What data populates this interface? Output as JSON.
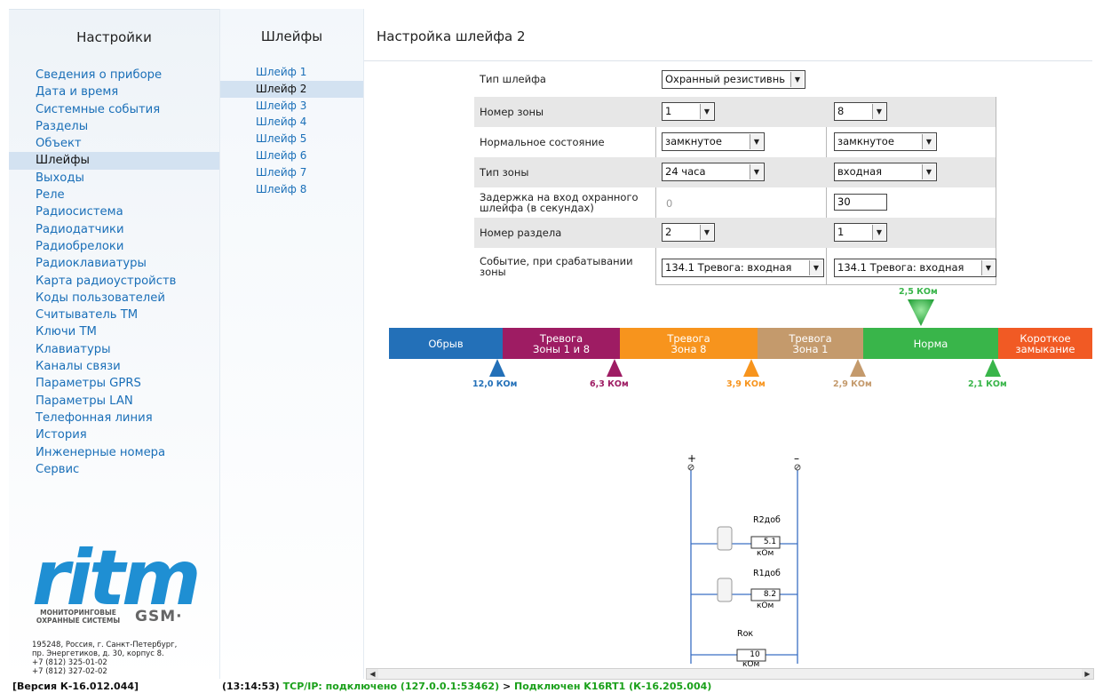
{
  "left": {
    "title": "Настройки",
    "items": [
      "Сведения о приборе",
      "Дата и время",
      "Системные события",
      "Разделы",
      "Объект",
      "Шлейфы",
      "Выходы",
      "Реле",
      "Радиосистема",
      "Радиодатчики",
      "Радиобрелоки",
      "Радиоклавиатуры",
      "Карта радиоустройств",
      "Коды пользователей",
      "Считыватель ТМ",
      "Ключи ТМ",
      "Клавиатуры",
      "Каналы связи",
      "Параметры GPRS",
      "Параметры LAN",
      "Телефонная линия",
      "История",
      "Инженерные номера",
      "Сервис"
    ],
    "active_index": 5
  },
  "logo": {
    "brand": "ritm",
    "tagline": "МОНИТОРИНГОВЫЕ ОХРАННЫЕ СИСТЕМЫ",
    "gsm": "GSM·"
  },
  "address": [
    "195248, Россия, г. Санкт-Петербург,",
    "пр. Энергетиков, д. 30, корпус 8.",
    "+7 (812) 325-01-02",
    "+7 (812) 327-02-02"
  ],
  "mid": {
    "title": "Шлейфы",
    "items": [
      "Шлейф 1",
      "Шлейф 2",
      "Шлейф 3",
      "Шлейф 4",
      "Шлейф 5",
      "Шлейф 6",
      "Шлейф 7",
      "Шлейф 8"
    ],
    "active_index": 1
  },
  "main": {
    "title": "Настройка шлейфа 2"
  },
  "form": {
    "loop_type_label": "Тип шлейфа",
    "loop_type_value": "Охранный резистивнь",
    "rows": [
      {
        "label": "Номер зоны",
        "a": "1",
        "b": "8"
      },
      {
        "label": "Нормальное состояние",
        "a": "замкнутое",
        "b": "замкнутое"
      },
      {
        "label": "Тип зоны",
        "a": "24 часа",
        "b": "входная"
      },
      {
        "label": "Задержка на вход охранного шлейфа (в секундах)",
        "a": "0",
        "b": "30"
      },
      {
        "label": "Номер раздела",
        "a": "2",
        "b": "1"
      },
      {
        "label": "Событие, при срабатывании зоны",
        "a": "134.1 Тревога: входная",
        "b": "134.1 Тревога: входная"
      }
    ]
  },
  "scale": {
    "segments": [
      {
        "label": "Обрыв",
        "color": "#2370b8"
      },
      {
        "label": "Тревога Зоны 1 и 8",
        "color": "#9e1c63"
      },
      {
        "label": "Тревога Зона 8",
        "color": "#f7941d"
      },
      {
        "label": "Тревога Зона 1",
        "color": "#c49a6c"
      },
      {
        "label": "Норма",
        "color": "#39b54a"
      },
      {
        "label": "Короткое замыкание",
        "color": "#f15a24"
      }
    ],
    "top_marker": {
      "label": "2,5 КОм",
      "color": "#39b54a"
    },
    "bottom_markers": [
      {
        "label": "12,0 КОм",
        "color": "#2370b8"
      },
      {
        "label": "6,3 КОм",
        "color": "#9e1c63"
      },
      {
        "label": "3,9 КОм",
        "color": "#f7941d"
      },
      {
        "label": "2,9 КОм",
        "color": "#c49a6c"
      },
      {
        "label": "2,1 КОм",
        "color": "#39b54a"
      }
    ]
  },
  "circuit": {
    "plus": "+",
    "minus": "–",
    "r2_name": "R2доб",
    "r2_value": "5.1",
    "r1_name": "R1доб",
    "r1_value": "8.2",
    "rok_name": "Rок",
    "rok_value": "10",
    "unit": "кОм"
  },
  "status": {
    "version": "[Версия К-16.012.044]",
    "time": "(13:14:53)",
    "connection": "TCP/IP: подключено (127.0.0.1:53462)",
    "arrow": " > ",
    "device": "Подключен K16RT1 (К-16.205.004)",
    "conn_color": "#1aa01a"
  }
}
